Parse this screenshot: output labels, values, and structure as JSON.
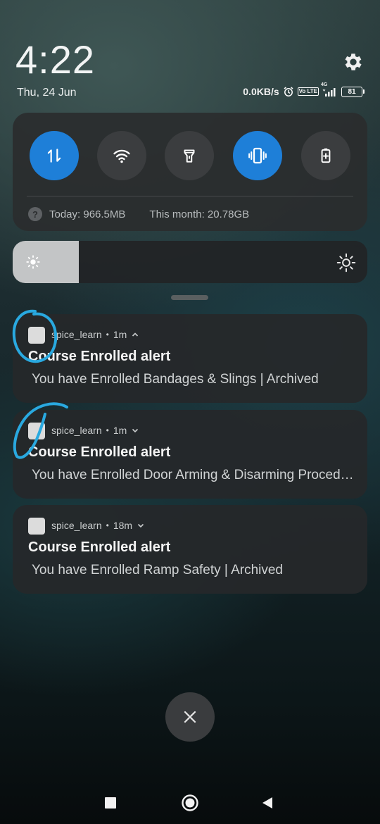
{
  "header": {
    "time": "4:22",
    "date": "Thu, 24 Jun",
    "net_speed": "0.0KB/s",
    "volte_label": "Vo LTE",
    "network_type": "4G",
    "battery_level": "81"
  },
  "quick_settings": {
    "toggles": [
      {
        "icon": "mobile-data-icon",
        "active": true
      },
      {
        "icon": "wifi-icon",
        "active": false
      },
      {
        "icon": "flashlight-icon",
        "active": false
      },
      {
        "icon": "vibrate-icon",
        "active": true
      },
      {
        "icon": "battery-saver-icon",
        "active": false
      }
    ],
    "data_today": "Today: 966.5MB",
    "data_month": "This month: 20.78GB",
    "help_glyph": "?"
  },
  "brightness": {
    "level_percent": 19
  },
  "notifications": [
    {
      "app": "spice_learn",
      "time": "1m",
      "expanded": true,
      "title": "Course Enrolled alert",
      "text": "You have Enrolled Bandages & Slings | Archived"
    },
    {
      "app": "spice_learn",
      "time": "1m",
      "expanded": false,
      "title": "Course Enrolled alert",
      "text": "You have Enrolled Door Arming & Disarming Procedure | Archived"
    },
    {
      "app": "spice_learn",
      "time": "18m",
      "expanded": false,
      "title": "Course Enrolled alert",
      "text": "You have Enrolled Ramp Safety | Archived"
    }
  ],
  "separator": "•",
  "colors": {
    "accent": "#1e7fd8",
    "annotation": "#29a9e0",
    "card": "#2a2c2e"
  }
}
